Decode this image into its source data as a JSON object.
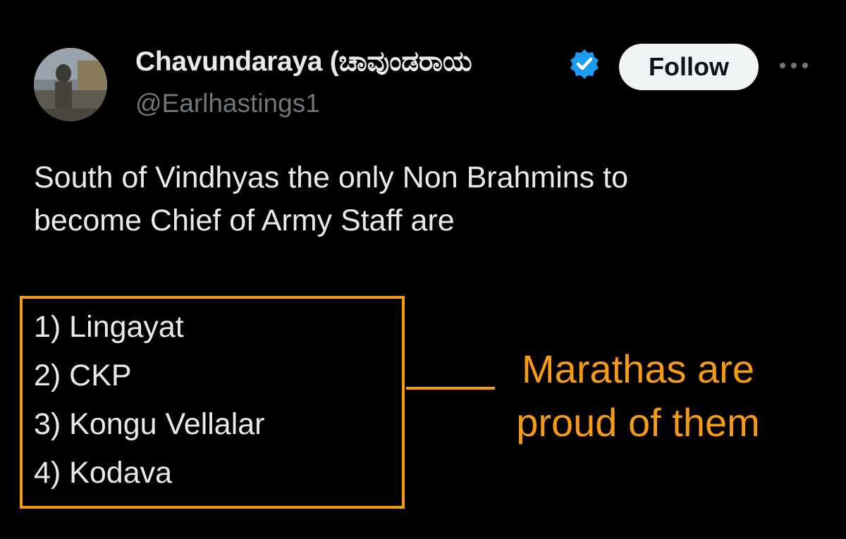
{
  "post": {
    "author": {
      "name": "Chavundaraya (ಚಾವುಂಡರಾಯ",
      "handle": "@Earlhastings1",
      "verified_icon": "verified-badge-icon",
      "avatar_icon": "statue-avatar"
    },
    "follow_label": "Follow",
    "more_icon": "more-options-icon",
    "text_lines": [
      "South of Vindhyas the only Non Brahmins to",
      "become Chief of Army Staff are"
    ],
    "list_items": [
      "1) Lingayat",
      "2) CKP",
      "3) Kongu Vellalar",
      "4) Kodava"
    ]
  },
  "annotation": {
    "lines": [
      "Marathas are",
      "proud of them"
    ]
  },
  "colors": {
    "background": "#000000",
    "text_primary": "#e7e9ea",
    "text_secondary": "#71767b",
    "annotation": "#f59a13",
    "verified": "#1d9bf0",
    "follow_bg": "#eff3f4"
  }
}
